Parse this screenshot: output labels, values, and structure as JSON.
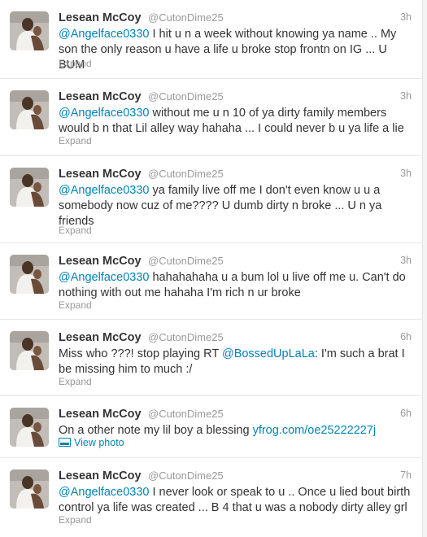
{
  "tweets": [
    {
      "fullname": "Lesean McCoy",
      "username": "@CutonDime25",
      "time": "3h",
      "mention": "@Angelface0330",
      "text": " I hit u n a week without knowing ya name .. My son the only reason u have a life u broke stop frontn on IG ... U BUM",
      "action": "Expand"
    },
    {
      "fullname": "Lesean McCoy",
      "username": "@CutonDime25",
      "time": "3h",
      "mention": "@Angelface0330",
      "text": " without me u n 10 of ya dirty family members would b n that Lil alley way hahaha ... I could never b u ya life a lie",
      "action": "Expand"
    },
    {
      "fullname": "Lesean McCoy",
      "username": "@CutonDime25",
      "time": "3h",
      "mention": "@Angelface0330",
      "text": " ya family live off me I don't even know u u a somebody now cuz of me???? U dumb dirty n broke ... U n ya friends",
      "action": "Expand"
    },
    {
      "fullname": "Lesean McCoy",
      "username": "@CutonDime25",
      "time": "3h",
      "mention": "@Angelface0330",
      "text": " hahahahaha u a bum lol u live off me u. Can't do nothing with out me hahaha I'm rich n ur broke",
      "action": "Expand"
    },
    {
      "fullname": "Lesean McCoy",
      "username": "@CutonDime25",
      "time": "6h",
      "text_before": "Miss who ???! stop playing RT ",
      "mention": "@BossedUpLaLa",
      "text": ": I'm such a brat I be missing him to much :/",
      "action": "Expand"
    },
    {
      "fullname": "Lesean McCoy",
      "username": "@CutonDime25",
      "time": "6h",
      "text_before": "On a other note my lil boy a blessing ",
      "link": "yfrog.com/oe25222227j",
      "action": "View photo"
    },
    {
      "fullname": "Lesean McCoy",
      "username": "@CutonDime25",
      "time": "7h",
      "mention": "@Angelface0330",
      "text": " I never look or speak to u .. Once u lied bout birth control ya life was created ... B 4 that u was a nobody dirty alley grl",
      "action": "Expand"
    }
  ],
  "colors": {
    "link": "#0084b4",
    "muted": "#999999",
    "text": "#333333",
    "divider": "#e8e8e8"
  },
  "icons": {
    "photo": "photo-icon",
    "avatar": "avatar"
  }
}
